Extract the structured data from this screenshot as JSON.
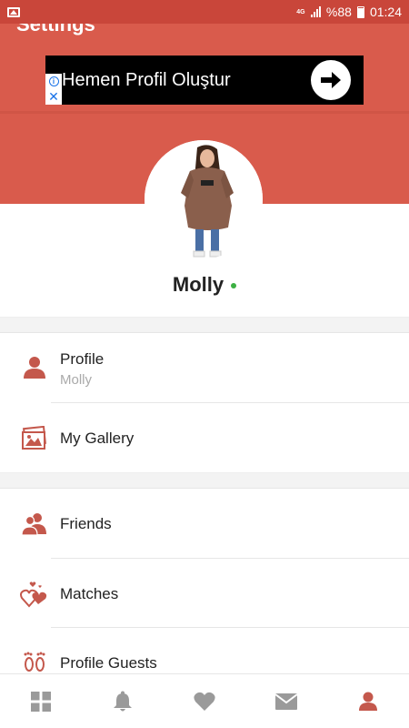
{
  "status_bar": {
    "network": "4G",
    "battery": "%88",
    "time": "01:24"
  },
  "header": {
    "title": "Settings"
  },
  "ad": {
    "text": "Hemen Profil Oluştur"
  },
  "profile": {
    "name": "Molly",
    "online": true
  },
  "menu": {
    "profile_label": "Profile",
    "profile_sub": "Molly",
    "gallery_label": "My Gallery",
    "friends_label": "Friends",
    "matches_label": "Matches",
    "guests_label": "Profile Guests"
  },
  "colors": {
    "accent": "#d95b4c",
    "status_bar": "#c9463a",
    "icon": "#c4584c",
    "inactive_icon": "#9a9a9a",
    "online": "#3cb043"
  },
  "bottom_nav": {
    "items": [
      {
        "icon": "grid-icon",
        "active": false
      },
      {
        "icon": "bell-icon",
        "active": false
      },
      {
        "icon": "heart-icon",
        "active": false
      },
      {
        "icon": "envelope-icon",
        "active": false
      },
      {
        "icon": "user-icon",
        "active": true
      }
    ]
  }
}
